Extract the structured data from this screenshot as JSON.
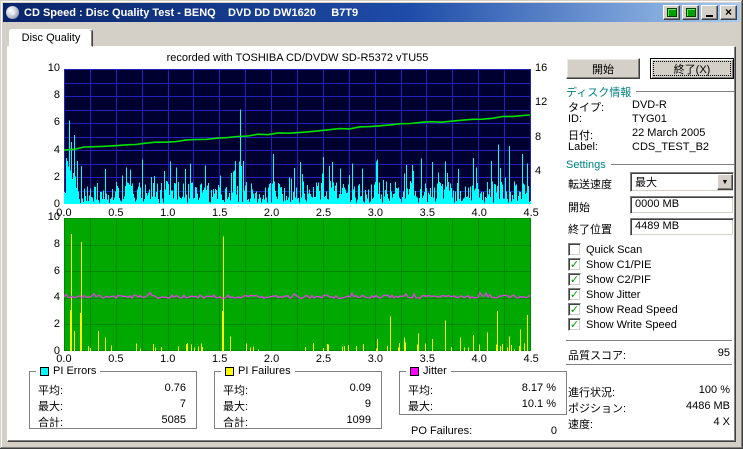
{
  "window": {
    "title": "CD Speed : Disc Quality Test - BENQ    DVD DD DW1620     B7T9"
  },
  "tab_label": "Disc Quality",
  "recorded_with": "recorded with TOSHIBA CD/DVDW SD-R5372 vTU55",
  "actions": {
    "start_button": "開始",
    "exit_button": "終了(X)"
  },
  "disc_info": {
    "header": "ディスク情報",
    "type_label": "タイプ:",
    "type_value": "DVD-R",
    "id_label": "ID:",
    "id_value": "TYG01",
    "date_label": "日付:",
    "date_value": "22 March 2005",
    "label_label": "Label:",
    "label_value": "CDS_TEST_B2"
  },
  "settings": {
    "header": "Settings",
    "transfer_label": "転送速度",
    "transfer_value": "最大",
    "start_label": "開始",
    "start_value": "0000 MB",
    "end_label": "終了位置",
    "end_value": "4489 MB",
    "checkboxes": [
      {
        "label": "Quick Scan",
        "checked": false
      },
      {
        "label": "Show C1/PIE",
        "checked": true
      },
      {
        "label": "Show C2/PIF",
        "checked": true
      },
      {
        "label": "Show Jitter",
        "checked": true
      },
      {
        "label": "Show Read Speed",
        "checked": true
      },
      {
        "label": "Show Write Speed",
        "checked": true
      }
    ]
  },
  "stats": {
    "quality_label": "品質スコア:",
    "quality_value": "95",
    "progress_label": "進行状況:",
    "progress_value": "100 %",
    "position_label": "ポジション:",
    "position_value": "4486 MB",
    "speed_label": "速度:",
    "speed_value": "4 X"
  },
  "legends": [
    {
      "title": "PI Errors",
      "color": "#00FFFF",
      "rows": [
        {
          "label": "平均:",
          "value": "0.76"
        },
        {
          "label": "最大:",
          "value": "7"
        },
        {
          "label": "合計:",
          "value": "5085"
        }
      ]
    },
    {
      "title": "PI Failures",
      "color": "#FFFF00",
      "rows": [
        {
          "label": "平均:",
          "value": "0.09"
        },
        {
          "label": "最大:",
          "value": "9"
        },
        {
          "label": "合計:",
          "value": "1099"
        }
      ]
    },
    {
      "title": "Jitter",
      "color": "#FF00FF",
      "rows": [
        {
          "label": "平均:",
          "value": "8.17 %"
        },
        {
          "label": "最大:",
          "value": "10.1 %"
        }
      ]
    }
  ],
  "po_failures": {
    "label": "PO Failures:",
    "value": "0"
  },
  "chart_data": {
    "type": "line",
    "x_unit": "GB",
    "x_range": [
      0,
      4.5
    ],
    "x_ticks": [
      "0.0",
      "0.5",
      "1.0",
      "1.5",
      "2.0",
      "2.5",
      "3.0",
      "3.5",
      "4.0",
      "4.5"
    ],
    "top_chart": {
      "description": "PI Errors (cyan spikes, left axis 0-10) with read speed line (green, right axis 0-16x)",
      "left_axis_ticks": [
        "10",
        "8",
        "6",
        "4",
        "2",
        "0"
      ],
      "right_axis_ticks": [
        "16",
        "12",
        "8",
        "4"
      ],
      "left_axis_range": [
        0,
        10
      ],
      "right_axis_range": [
        0,
        16
      ],
      "bg": "#000030",
      "grid": "#2121BE",
      "pie_spike_color": "#00FFFF",
      "speed_line_color": "#00E000",
      "speed_line_start": 4.05,
      "speed_line_end": 6.6,
      "pie_average": 0.76,
      "pie_max": 7,
      "pie_total": 5085,
      "features": [
        [
          0.02,
          3.4
        ],
        [
          0.045,
          6.2
        ],
        [
          0.07,
          4.6
        ],
        [
          0.1,
          5.1
        ],
        [
          0.125,
          3.2
        ],
        [
          0.16,
          2.8
        ],
        [
          0.4,
          2.6
        ],
        [
          0.75,
          3.3
        ],
        [
          1.08,
          2.7
        ],
        [
          1.7,
          7.0
        ],
        [
          1.73,
          3.2
        ],
        [
          2.02,
          3.7
        ],
        [
          2.28,
          3.1
        ],
        [
          2.5,
          3.5
        ],
        [
          2.78,
          3.0
        ],
        [
          3.02,
          3.3
        ],
        [
          3.3,
          2.9
        ],
        [
          3.55,
          3.1
        ],
        [
          3.95,
          3.4
        ],
        [
          4.12,
          3.2
        ],
        [
          4.3,
          4.3
        ],
        [
          4.42,
          3.7
        ],
        [
          4.47,
          3.0
        ]
      ]
    },
    "bottom_chart": {
      "description": "PI Failures (yellow spikes, axis 0-10) with jitter line (magenta, ~8.2%)",
      "left_axis_ticks": [
        "10",
        "8",
        "6",
        "4",
        "2",
        "0"
      ],
      "left_axis_range": [
        0,
        10
      ],
      "bg": "#00A800",
      "grid": "#008800",
      "pif_spike_color": "#FFFF00",
      "jitter_line_color": "#E040E0",
      "jitter_level": 4.08,
      "pif_average": 0.09,
      "pif_max": 9,
      "pif_total": 1099,
      "jitter_average_pct": 8.17,
      "jitter_max_pct": 10.1,
      "features": [
        [
          0.07,
          8.8
        ],
        [
          0.1,
          1.5
        ],
        [
          0.16,
          8.2
        ],
        [
          0.33,
          1.5
        ],
        [
          0.4,
          1.0
        ],
        [
          1.54,
          8.6
        ],
        [
          1.6,
          1.1
        ],
        [
          3.02,
          0.9
        ],
        [
          3.15,
          2.6
        ],
        [
          3.28,
          1.0
        ],
        [
          3.42,
          1.3
        ],
        [
          3.55,
          0.9
        ],
        [
          3.68,
          2.3
        ],
        [
          3.82,
          1.0
        ],
        [
          3.95,
          1.2
        ],
        [
          4.08,
          1.4
        ],
        [
          4.18,
          3.0
        ],
        [
          4.3,
          1.1
        ],
        [
          4.4,
          1.6
        ],
        [
          4.47,
          2.7
        ]
      ]
    }
  }
}
